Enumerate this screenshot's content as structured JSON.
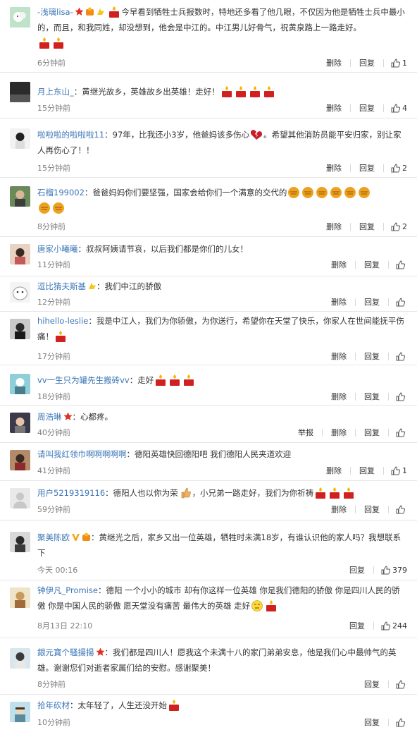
{
  "actions": {
    "delete": "删除",
    "reply": "回复",
    "report": "举报"
  },
  "colors": {
    "name": "#3b75b6",
    "time": "#808080",
    "candle": "#d02020",
    "fist": "#f0a020"
  },
  "comments": [
    {
      "name": "-浅璃lisa-",
      "badges": [
        "red-star-badge",
        "vip-badge",
        "yellow-badge"
      ],
      "text": "今早看到牺牲士兵报数时，特地还多看了他几眼，不仅因为他是牺牲士兵中最小的，而且，和我同姓，却没想到，他会是中江的。中江男儿好骨气，祝黄泉路上一路走好。",
      "time": "6分钟前",
      "likes": "1"
    },
    {
      "name": "月上东山_",
      "badges": [],
      "text": "：黄继光故乡，英雄故乡出英雄！走好！",
      "time": "15分钟前",
      "likes": "4"
    },
    {
      "name": "啦啦啦的啦啦啦11",
      "badges": [],
      "text": "：97年，比我还小3岁，他爸妈该多伤心",
      "text2": "。希望其他消防员能平安归家，别让家人再伤心了！！",
      "time": "15分钟前",
      "likes": "2"
    },
    {
      "name": "石榴199002",
      "badges": [],
      "text": "：爸爸妈妈你们要坚强，国家会给你们一个满意的交代的",
      "time": "8分钟前",
      "likes": "2"
    },
    {
      "name": "唐家小曦曦",
      "badges": [],
      "text": "：叔叔阿姨请节哀，以后我们都是你们的儿女！",
      "time": "11分钟前",
      "likes": ""
    },
    {
      "name": "逗比猜夫斯基",
      "badges": [
        "yellow-badge"
      ],
      "text": "：我们中江的骄傲",
      "time": "12分钟前",
      "likes": ""
    },
    {
      "name": "hihello-leslie",
      "badges": [],
      "text": "：我是中江人，我们为你骄傲，为你送行，希望你在天堂了快乐，你家人在世间能抚平伤痛！",
      "time": "17分钟前",
      "likes": ""
    },
    {
      "name": "vv一生只为罐先生搬砖vv",
      "badges": [],
      "text": "：走好",
      "time": "18分钟前",
      "likes": ""
    },
    {
      "name": "周浩琳",
      "badges": [
        "red-star-badge"
      ],
      "text": "：心都疼。",
      "time": "40分钟前",
      "likes": ""
    },
    {
      "name": "请叫我红领巾啊啊啊啊啊",
      "badges": [],
      "text": "：德阳英雄快回德阳吧 我们德阳人民夹道欢迎",
      "time": "41分钟前",
      "likes": "1"
    },
    {
      "name": "用户5219319116",
      "badges": [],
      "text": "：德阳人也以你为荣",
      "text2": "，小兄弟一路走好，我们为你祈祷",
      "time": "59分钟前",
      "likes": ""
    },
    {
      "name": "聚美陈欧",
      "badges": [
        "vip-v-badge",
        "vip-badge"
      ],
      "text": "：黄继光之后，家乡又出一位英雄，牺牲时未满18岁，有谁认识他的家人吗？我想联系下",
      "time": "今天 00:16",
      "likes": "379"
    },
    {
      "name": "钟伊凡_Promise",
      "badges": [],
      "text": "：德阳 一个小小的城市 却有你这样一位英雄 你是我们德阳的骄傲 你是四川人民的骄傲 你是中国人民的骄傲 愿天堂没有痛苦 最伟大的英雄 走好",
      "time": "8月13日 22:10",
      "likes": "244"
    },
    {
      "name": "銀元寶个騷揚揚",
      "badges": [
        "red-star-badge"
      ],
      "text": "：我们都是四川人！愿我这个未满十八的家门弟弟安息，他是我们心中最帅气的英雄。谢谢您们对逝者家属们给的安慰。感谢聚美！",
      "time": "8分钟前",
      "likes": ""
    },
    {
      "name": "拾年砍材",
      "badges": [],
      "text": "：太年轻了，人生还没开始",
      "time": "10分钟前",
      "likes": ""
    }
  ]
}
